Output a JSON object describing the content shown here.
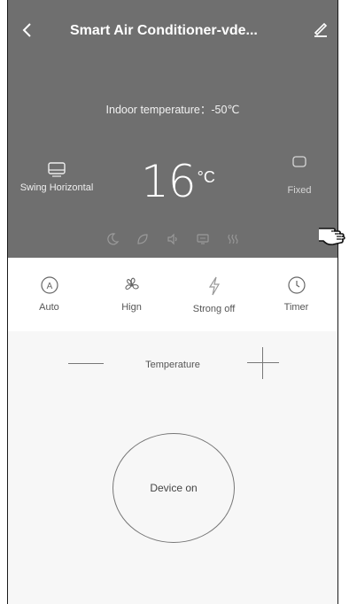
{
  "header": {
    "title": "Smart Air Conditioner-vde...",
    "back_icon": "chevron-left-icon",
    "edit_icon": "edit-icon"
  },
  "status": {
    "indoor_temperature": "Indoor temperature：-50℃",
    "set_temperature": "16",
    "unit": "°C",
    "swing_label": "Swing Horizontal",
    "fixed_label": "Fixed"
  },
  "modes": [
    {
      "label": "Auto",
      "icon": "auto-mode-icon"
    },
    {
      "label": "Hign",
      "icon": "fan-icon"
    },
    {
      "label": "Strong off",
      "icon": "lightning-icon"
    },
    {
      "label": "Timer",
      "icon": "clock-icon"
    }
  ],
  "temperature": {
    "label": "Temperature"
  },
  "power": {
    "label": "Device on"
  },
  "colors": {
    "panel": "#6f6f6f",
    "text_light": "#ffffff"
  }
}
